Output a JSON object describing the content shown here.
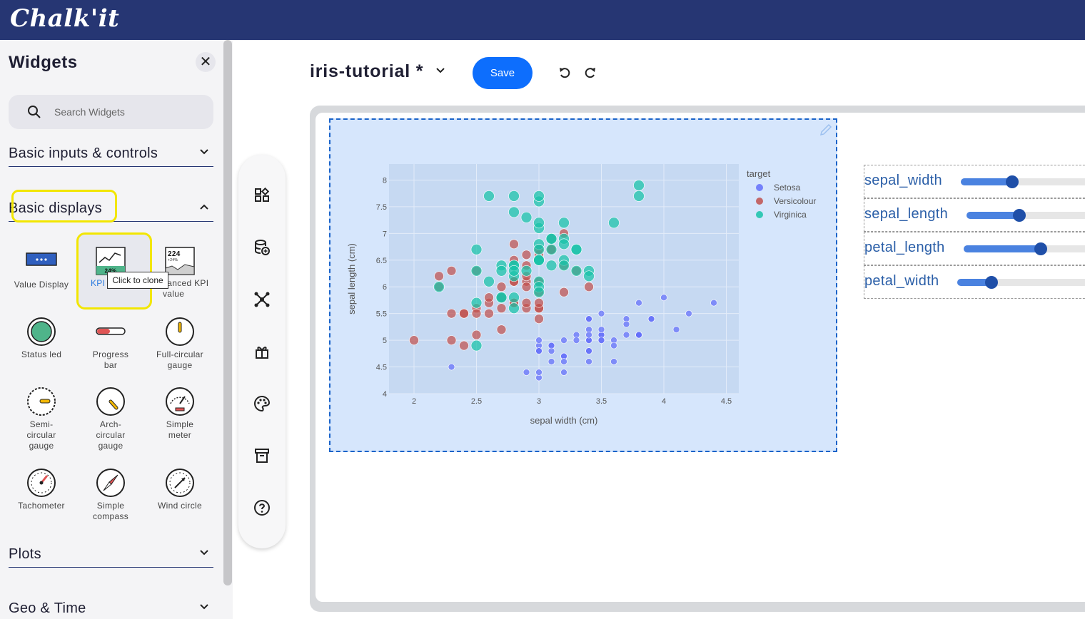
{
  "app": {
    "logo": "Chalk'it"
  },
  "sidebar": {
    "title": "Widgets",
    "search_placeholder": "Search Widgets",
    "categories": [
      {
        "label": "Basic inputs & controls",
        "expanded": false
      },
      {
        "label": "Basic displays",
        "expanded": true
      },
      {
        "label": "Plots",
        "expanded": false
      },
      {
        "label": "Geo & Time",
        "expanded": false
      }
    ],
    "widgets": [
      {
        "label": "Value Display"
      },
      {
        "label": "KPI"
      },
      {
        "label": "Advanced KPI value"
      },
      {
        "label": "Status led"
      },
      {
        "label": "Progress bar"
      },
      {
        "label": "Full-circular gauge"
      },
      {
        "label": "Semi-circular gauge"
      },
      {
        "label": "Arch-circular gauge"
      },
      {
        "label": "Simple meter"
      },
      {
        "label": "Tachometer"
      },
      {
        "label": "Simple compass"
      },
      {
        "label": "Wind circle"
      }
    ],
    "kpi_icon_text": "24%",
    "adv_kpi_icon_text": "224",
    "adv_kpi_icon_sub": "+24%",
    "tooltip": "Click to clone",
    "visible": {
      "kpi_label": "KPI",
      "adv_kpi_label": "vanced KPI value"
    }
  },
  "header": {
    "project_name": "iris-tutorial *",
    "save_label": "Save"
  },
  "toolbox": {
    "icons": [
      "widgets-icon",
      "datanodes-icon",
      "graph-icon",
      "export-icon",
      "palette-icon",
      "archive-icon",
      "help-icon"
    ]
  },
  "sliders": [
    {
      "label": "sepal_width",
      "value_frac": 0.3
    },
    {
      "label": "sepal_length",
      "value_frac": 0.31
    },
    {
      "label": "petal_length",
      "value_frac": 0.45
    },
    {
      "label": "petal_width",
      "value_frac": 0.2
    }
  ],
  "colors": {
    "topbar": "#263673",
    "setosa": "#636efa",
    "versicolour": "#c0504d",
    "virginica": "#18c2a8",
    "accent": "#0d6efd"
  },
  "chart_data": {
    "type": "scatter",
    "xlabel": "sepal width (cm)",
    "ylabel": "sepal length (cm)",
    "xlim": [
      1.8,
      4.6
    ],
    "ylim": [
      4,
      8.3
    ],
    "xticks": [
      2,
      2.5,
      3,
      3.5,
      4,
      4.5
    ],
    "yticks": [
      4,
      4.5,
      5,
      5.5,
      6,
      6.5,
      7,
      7.5,
      8
    ],
    "legend": {
      "title": "target",
      "position": "top-right"
    },
    "series": [
      {
        "name": "Setosa",
        "color": "#636efa",
        "size": 7,
        "points": [
          [
            3.5,
            5.1
          ],
          [
            3.0,
            4.9
          ],
          [
            3.2,
            4.7
          ],
          [
            3.1,
            4.6
          ],
          [
            3.6,
            5.0
          ],
          [
            3.9,
            5.4
          ],
          [
            3.4,
            4.6
          ],
          [
            3.4,
            5.0
          ],
          [
            2.9,
            4.4
          ],
          [
            3.1,
            4.9
          ],
          [
            3.7,
            5.4
          ],
          [
            3.4,
            4.8
          ],
          [
            3.0,
            4.8
          ],
          [
            3.0,
            4.3
          ],
          [
            4.0,
            5.8
          ],
          [
            4.4,
            5.7
          ],
          [
            3.9,
            5.4
          ],
          [
            3.5,
            5.1
          ],
          [
            3.8,
            5.7
          ],
          [
            3.8,
            5.1
          ],
          [
            3.4,
            5.4
          ],
          [
            3.7,
            5.1
          ],
          [
            3.6,
            4.6
          ],
          [
            3.3,
            5.1
          ],
          [
            3.4,
            4.8
          ],
          [
            3.0,
            5.0
          ],
          [
            3.4,
            5.0
          ],
          [
            3.5,
            5.2
          ],
          [
            3.4,
            5.2
          ],
          [
            3.2,
            4.7
          ],
          [
            3.1,
            4.8
          ],
          [
            3.4,
            5.4
          ],
          [
            4.1,
            5.2
          ],
          [
            4.2,
            5.5
          ],
          [
            3.1,
            4.9
          ],
          [
            3.2,
            5.0
          ],
          [
            3.5,
            5.5
          ],
          [
            3.6,
            4.9
          ],
          [
            3.0,
            4.4
          ],
          [
            3.4,
            5.1
          ],
          [
            3.5,
            5.0
          ],
          [
            2.3,
            4.5
          ],
          [
            3.2,
            4.4
          ],
          [
            3.5,
            5.0
          ],
          [
            3.8,
            5.1
          ],
          [
            3.0,
            4.8
          ],
          [
            3.8,
            5.1
          ],
          [
            3.2,
            4.6
          ],
          [
            3.7,
            5.3
          ],
          [
            3.3,
            5.0
          ]
        ]
      },
      {
        "name": "Versicolour",
        "color": "#c0504d",
        "size": 13,
        "points": [
          [
            3.2,
            7.0
          ],
          [
            3.2,
            6.4
          ],
          [
            3.1,
            6.9
          ],
          [
            2.3,
            5.5
          ],
          [
            2.8,
            6.5
          ],
          [
            2.8,
            5.7
          ],
          [
            3.3,
            6.3
          ],
          [
            2.4,
            4.9
          ],
          [
            2.9,
            6.6
          ],
          [
            2.7,
            5.2
          ],
          [
            2.0,
            5.0
          ],
          [
            3.0,
            5.9
          ],
          [
            2.2,
            6.0
          ],
          [
            2.9,
            6.1
          ],
          [
            2.9,
            5.6
          ],
          [
            3.1,
            6.7
          ],
          [
            3.0,
            5.6
          ],
          [
            2.7,
            5.8
          ],
          [
            2.2,
            6.2
          ],
          [
            2.5,
            5.6
          ],
          [
            3.2,
            5.9
          ],
          [
            2.8,
            6.1
          ],
          [
            2.5,
            6.3
          ],
          [
            2.8,
            6.1
          ],
          [
            2.9,
            6.4
          ],
          [
            3.0,
            6.6
          ],
          [
            2.8,
            6.8
          ],
          [
            3.0,
            6.7
          ],
          [
            2.9,
            6.0
          ],
          [
            2.6,
            5.7
          ],
          [
            2.4,
            5.5
          ],
          [
            2.4,
            5.5
          ],
          [
            2.7,
            5.8
          ],
          [
            2.7,
            6.0
          ],
          [
            3.0,
            5.4
          ],
          [
            3.4,
            6.0
          ],
          [
            3.1,
            6.7
          ],
          [
            2.3,
            6.3
          ],
          [
            3.0,
            5.6
          ],
          [
            2.5,
            5.5
          ],
          [
            2.6,
            5.5
          ],
          [
            3.0,
            6.1
          ],
          [
            2.6,
            5.8
          ],
          [
            2.3,
            5.0
          ],
          [
            2.7,
            5.6
          ],
          [
            3.0,
            5.7
          ],
          [
            2.9,
            5.7
          ],
          [
            2.9,
            6.2
          ],
          [
            2.5,
            5.1
          ],
          [
            2.8,
            5.7
          ]
        ]
      },
      {
        "name": "Virginica",
        "color": "#18c2a8",
        "size": 15,
        "points": [
          [
            3.3,
            6.3
          ],
          [
            2.7,
            5.8
          ],
          [
            3.0,
            7.1
          ],
          [
            2.9,
            6.3
          ],
          [
            3.0,
            6.5
          ],
          [
            3.0,
            7.6
          ],
          [
            2.5,
            4.9
          ],
          [
            2.9,
            7.3
          ],
          [
            2.5,
            6.7
          ],
          [
            3.6,
            7.2
          ],
          [
            3.2,
            6.5
          ],
          [
            2.7,
            6.4
          ],
          [
            3.0,
            6.8
          ],
          [
            2.5,
            5.7
          ],
          [
            2.8,
            5.8
          ],
          [
            3.2,
            6.4
          ],
          [
            3.0,
            6.5
          ],
          [
            3.8,
            7.7
          ],
          [
            2.6,
            7.7
          ],
          [
            2.2,
            6.0
          ],
          [
            3.2,
            6.9
          ],
          [
            2.8,
            5.6
          ],
          [
            2.8,
            7.7
          ],
          [
            2.7,
            6.3
          ],
          [
            3.3,
            6.7
          ],
          [
            3.2,
            7.2
          ],
          [
            2.8,
            6.2
          ],
          [
            3.0,
            6.1
          ],
          [
            2.8,
            6.4
          ],
          [
            3.0,
            7.2
          ],
          [
            2.8,
            7.4
          ],
          [
            3.8,
            7.9
          ],
          [
            2.8,
            6.4
          ],
          [
            2.8,
            6.3
          ],
          [
            2.6,
            6.1
          ],
          [
            3.0,
            7.7
          ],
          [
            3.4,
            6.3
          ],
          [
            3.1,
            6.4
          ],
          [
            3.0,
            6.0
          ],
          [
            3.1,
            6.9
          ],
          [
            3.1,
            6.7
          ],
          [
            3.1,
            6.9
          ],
          [
            2.7,
            5.8
          ],
          [
            3.2,
            6.8
          ],
          [
            3.3,
            6.7
          ],
          [
            3.0,
            6.7
          ],
          [
            2.5,
            6.3
          ],
          [
            3.0,
            6.5
          ],
          [
            3.4,
            6.2
          ],
          [
            3.0,
            5.9
          ]
        ]
      }
    ]
  }
}
